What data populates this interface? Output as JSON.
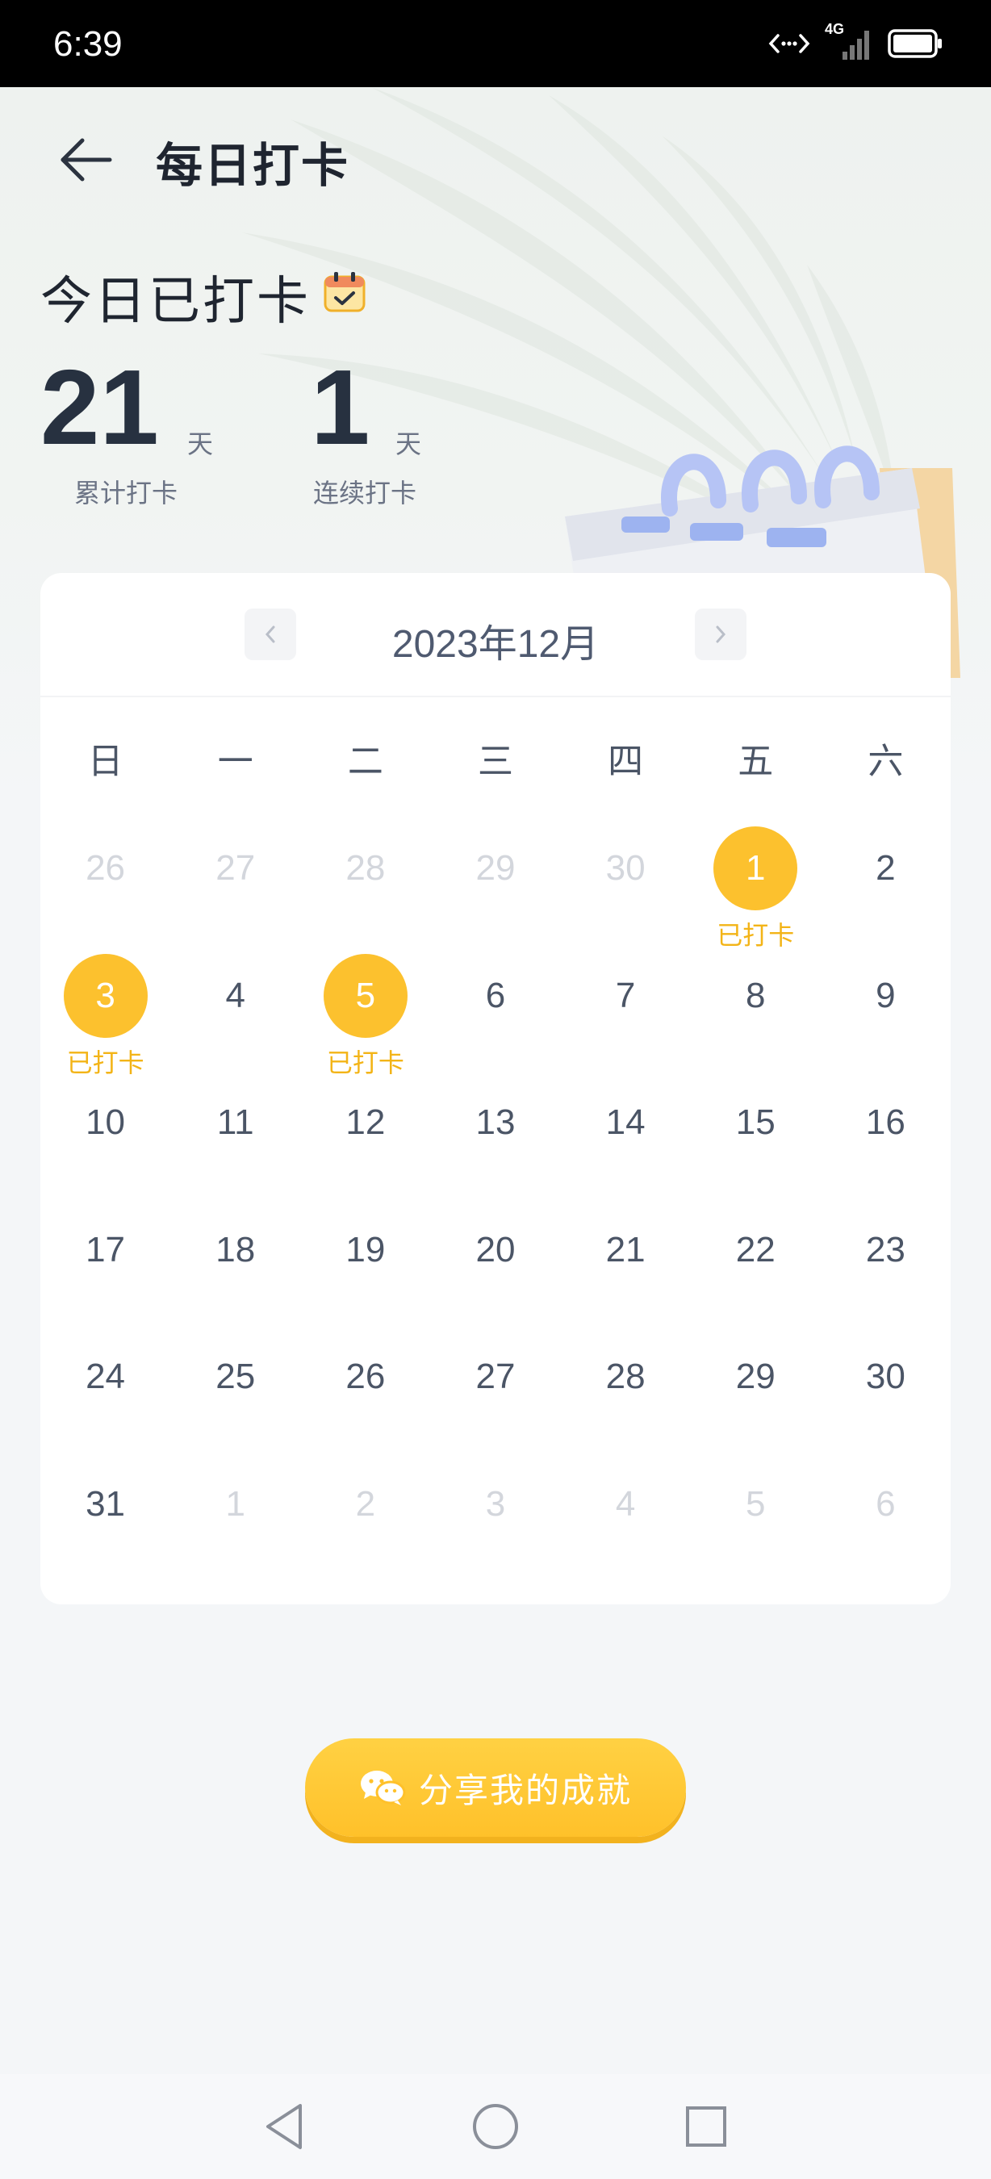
{
  "status_bar": {
    "time": "6:39",
    "network": "4G"
  },
  "header": {
    "title": "每日打卡"
  },
  "checkin": {
    "status": "今日已打卡",
    "total": {
      "value": "21",
      "unit": "天",
      "label": "累计打卡"
    },
    "streak": {
      "value": "1",
      "unit": "天",
      "label": "连续打卡"
    }
  },
  "calendar": {
    "month": "2023年12月",
    "weekdays": [
      "日",
      "一",
      "二",
      "三",
      "四",
      "五",
      "六"
    ],
    "checked_label": "已打卡",
    "days": [
      {
        "d": "26",
        "m": true
      },
      {
        "d": "27",
        "m": true
      },
      {
        "d": "28",
        "m": true
      },
      {
        "d": "29",
        "m": true
      },
      {
        "d": "30",
        "m": true
      },
      {
        "d": "1",
        "c": true
      },
      {
        "d": "2"
      },
      {
        "d": "3",
        "c": true
      },
      {
        "d": "4"
      },
      {
        "d": "5",
        "c": true
      },
      {
        "d": "6"
      },
      {
        "d": "7"
      },
      {
        "d": "8"
      },
      {
        "d": "9"
      },
      {
        "d": "10"
      },
      {
        "d": "11"
      },
      {
        "d": "12"
      },
      {
        "d": "13"
      },
      {
        "d": "14"
      },
      {
        "d": "15"
      },
      {
        "d": "16"
      },
      {
        "d": "17"
      },
      {
        "d": "18"
      },
      {
        "d": "19"
      },
      {
        "d": "20"
      },
      {
        "d": "21"
      },
      {
        "d": "22"
      },
      {
        "d": "23"
      },
      {
        "d": "24"
      },
      {
        "d": "25"
      },
      {
        "d": "26"
      },
      {
        "d": "27"
      },
      {
        "d": "28"
      },
      {
        "d": "29"
      },
      {
        "d": "30"
      },
      {
        "d": "31"
      },
      {
        "d": "1",
        "m": true
      },
      {
        "d": "2",
        "m": true
      },
      {
        "d": "3",
        "m": true
      },
      {
        "d": "4",
        "m": true
      },
      {
        "d": "5",
        "m": true
      },
      {
        "d": "6",
        "m": true
      }
    ]
  },
  "share": {
    "label": "分享我的成就"
  },
  "colors": {
    "accent": "#fcc12e",
    "card": "#ffffff",
    "background": "#f4f6f8"
  },
  "icons": {
    "back": "arrow-left-icon",
    "calendar": "calendar-check-icon",
    "wechat": "wechat-icon",
    "prev": "chevron-left-icon",
    "next": "chevron-right-icon"
  }
}
